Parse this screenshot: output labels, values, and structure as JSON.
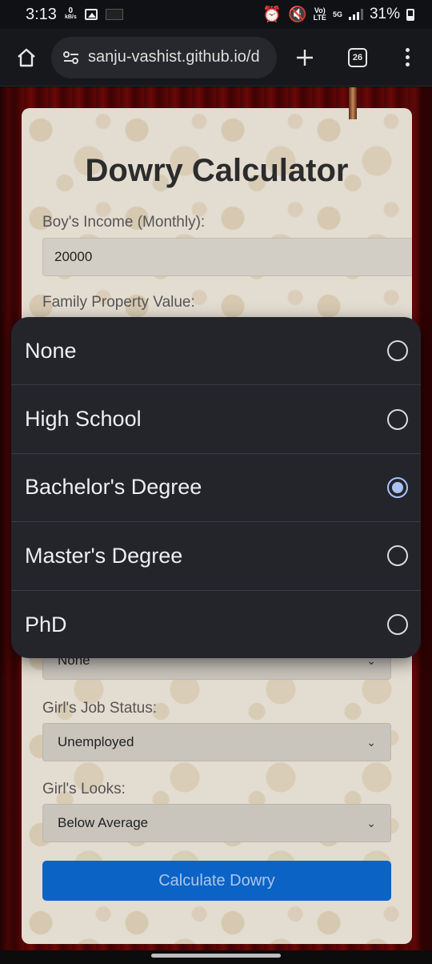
{
  "status_bar": {
    "time": "3:13",
    "net_speed_value": "0",
    "net_speed_unit": "kB/s",
    "network_label_top": "Vo)",
    "network_label_bottom": "LTE",
    "gen_label": "5G",
    "battery": "31%"
  },
  "browser": {
    "url": "sanju-vashist.github.io/d",
    "tab_count": "26"
  },
  "form": {
    "title": "Dowry Calculator",
    "boy_income_label": "Boy's Income (Monthly):",
    "boy_income_value": "20000",
    "property_label": "Family Property Value:",
    "education_value": "None",
    "job_label": "Girl's Job Status:",
    "job_value": "Unemployed",
    "looks_label": "Girl's Looks:",
    "looks_value": "Below Average",
    "calculate_label": "Calculate Dowry"
  },
  "dropdown": {
    "options": [
      {
        "label": "None",
        "selected": false
      },
      {
        "label": "High School",
        "selected": false
      },
      {
        "label": "Bachelor's Degree",
        "selected": true
      },
      {
        "label": "Master's Degree",
        "selected": false
      },
      {
        "label": "PhD",
        "selected": false
      }
    ]
  },
  "colors": {
    "accent": "#0b63c6",
    "radio_selected": "#a9c1f3",
    "sheet_background": "#23252b"
  }
}
